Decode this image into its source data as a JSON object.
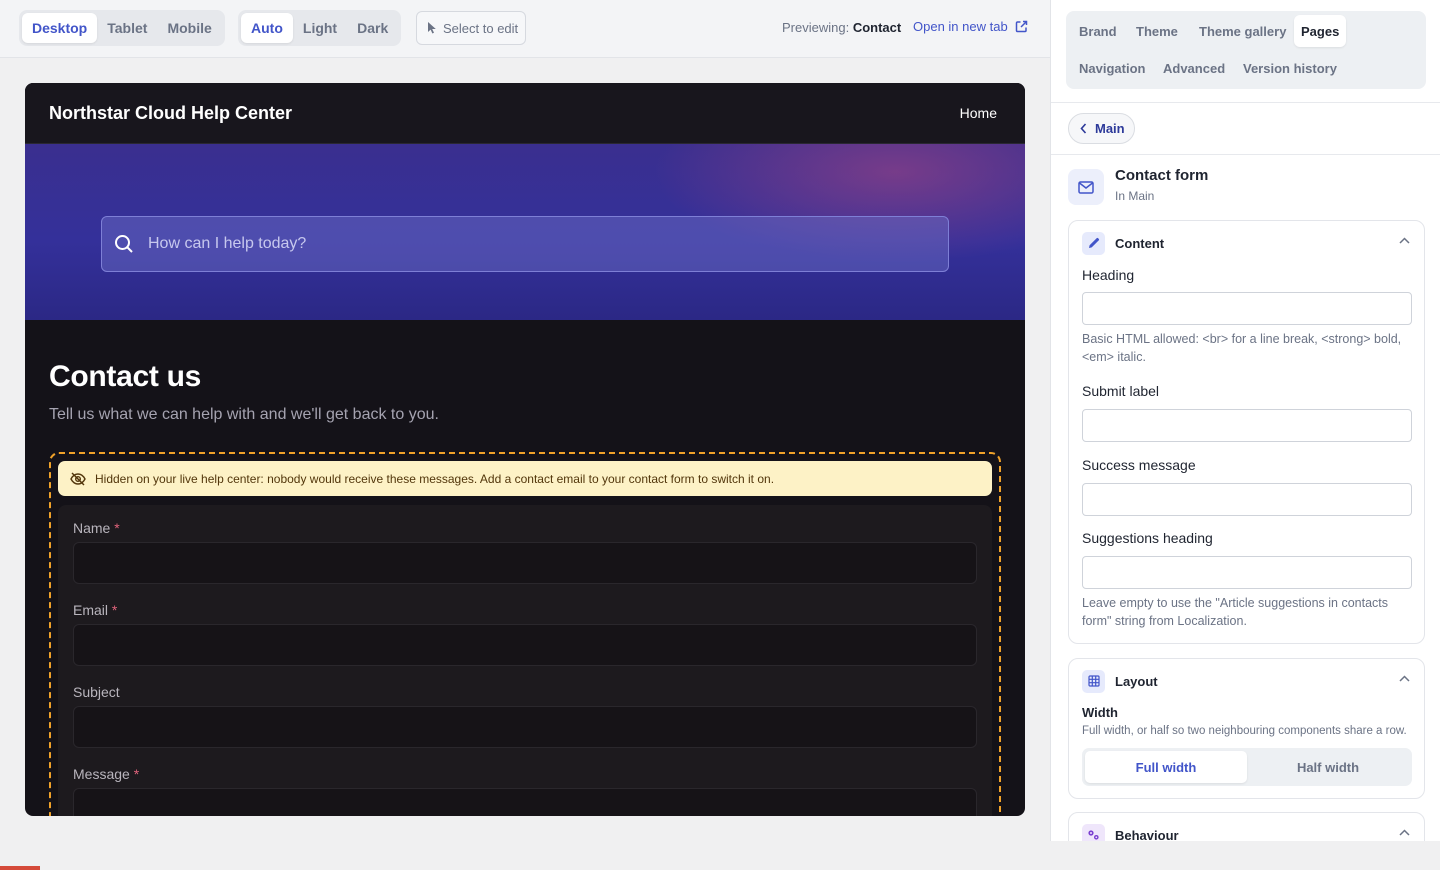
{
  "toolbar": {
    "device_options": [
      "Desktop",
      "Tablet",
      "Mobile"
    ],
    "device_selected": "Desktop",
    "mode_options": [
      "Auto",
      "Light",
      "Dark"
    ],
    "mode_selected": "Auto",
    "select_to_edit": "Select to edit",
    "previewing_label": "Previewing:",
    "previewing_page": "Contact",
    "open_new_tab": "Open in new tab"
  },
  "preview": {
    "site_title": "Northstar Cloud Help Center",
    "nav_home": "Home",
    "search_placeholder": "How can I help today?",
    "heading": "Contact us",
    "subheading": "Tell us what we can help with and we'll get back to you.",
    "warning": "Hidden on your live help center: nobody would receive these messages. Add a contact email to your contact form to switch it on.",
    "fields": [
      {
        "label": "Name",
        "required": "*"
      },
      {
        "label": "Email",
        "required": "*"
      },
      {
        "label": "Subject",
        "required": ""
      },
      {
        "label": "Message",
        "required": "*"
      }
    ]
  },
  "panel": {
    "tabs": [
      "Brand",
      "Theme",
      "Theme gallery",
      "Pages",
      "Navigation",
      "Advanced",
      "Version history"
    ],
    "active_tab": "Pages",
    "back_label": "Main",
    "component_title": "Contact form",
    "component_sub": "In Main",
    "content": {
      "title": "Content",
      "heading_label": "Heading",
      "heading_value": "",
      "heading_help": "Basic HTML allowed: <br> for a line break, <strong> bold, <em> italic.",
      "submit_label": "Submit label",
      "submit_value": "",
      "success_label": "Success message",
      "success_value": "",
      "suggestions_label": "Suggestions heading",
      "suggestions_value": "",
      "suggestions_help": "Leave empty to use the \"Article suggestions in contacts form\" string from Localization."
    },
    "layout": {
      "title": "Layout",
      "width_label": "Width",
      "width_help": "Full width, or half so two neighbouring components share a row.",
      "width_options": [
        "Full width",
        "Half width"
      ],
      "width_selected": "Full width"
    },
    "behaviour": {
      "title": "Behaviour"
    }
  },
  "colors": {
    "accent": "#4255c9",
    "hero": "#34309a",
    "warning_bg": "#fdf2c6",
    "warning_border": "#f0a22a",
    "required": "#e0637b"
  }
}
